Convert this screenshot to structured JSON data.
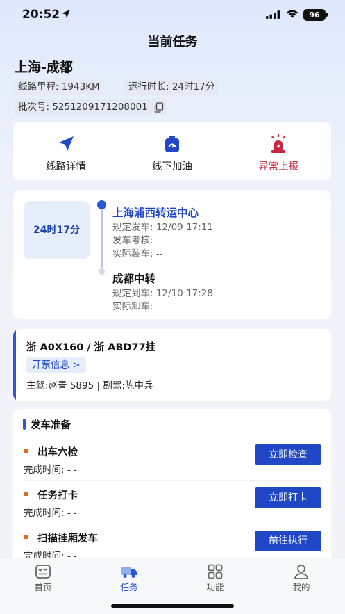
{
  "status_bar": {
    "time": "20:52",
    "battery": "96"
  },
  "header": {
    "title": "当前任务"
  },
  "route": {
    "title": "上海-成都",
    "distance": "线路里程: 1943KM",
    "duration": "运行时长: 24时17分",
    "batch": "批次号: 5251209171208001"
  },
  "actions": [
    {
      "label": "线路详情",
      "icon": "navigation-arrow-icon"
    },
    {
      "label": "线下加油",
      "icon": "fuel-icon"
    },
    {
      "label": "异常上报",
      "icon": "alarm-siren-icon"
    }
  ],
  "timeline": {
    "duration": "24时17分",
    "origin": {
      "name": "上海浦西转运中心",
      "lines": [
        "规定发车: 12/09 17:11",
        "发车考核: --",
        "实际装车: --"
      ]
    },
    "destination": {
      "name": "成都中转",
      "lines": [
        "规定到车: 12/10 17:28",
        "实际卸车: --"
      ]
    }
  },
  "vehicle": {
    "plates": "浙 A0X160 / 浙 ABD77挂",
    "invoice": "开票信息 >",
    "drivers": "主驾:赵青 5895 | 副驾:陈中兵"
  },
  "prep": {
    "title": "发车准备",
    "tasks": [
      {
        "name": "出车六检",
        "time": "完成时间: - -",
        "button": "立即检查"
      },
      {
        "name": "任务打卡",
        "time": "完成时间: - -",
        "button": "立即打卡"
      },
      {
        "name": "扫描挂厢发车",
        "time": "完成时间: - -",
        "button": "前往执行"
      }
    ]
  },
  "tabs": [
    {
      "label": "首页",
      "icon": "home-list-icon",
      "active": false
    },
    {
      "label": "任务",
      "icon": "truck-icon",
      "active": true
    },
    {
      "label": "功能",
      "icon": "grid-icon",
      "active": false
    },
    {
      "label": "我的",
      "icon": "user-icon",
      "active": false
    }
  ],
  "colors": {
    "primary": "#1f47c6",
    "alert": "#c5283f",
    "bullet": "#e26a1f"
  }
}
